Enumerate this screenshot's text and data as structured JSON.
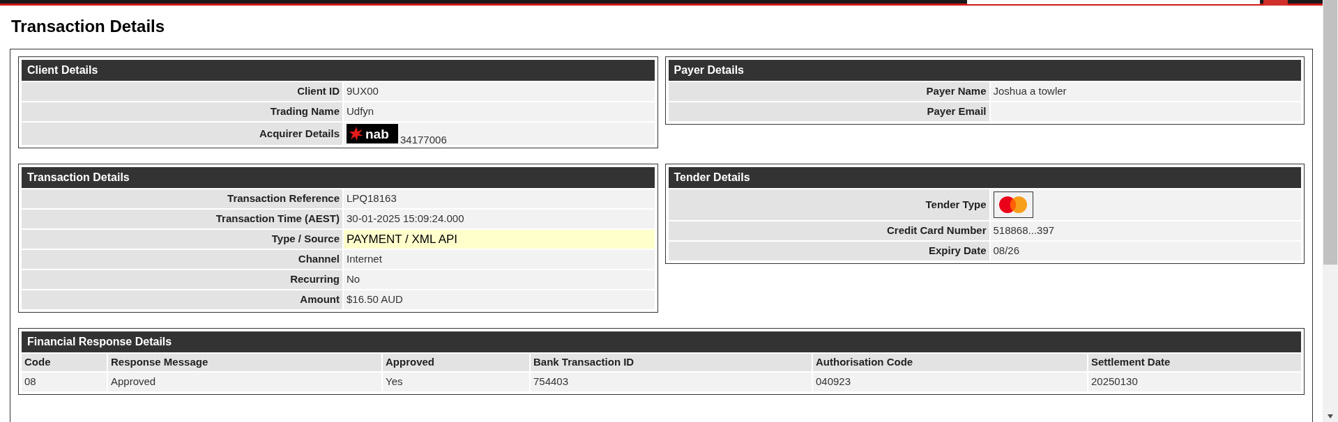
{
  "page_title": "Transaction Details",
  "panels": [
    {
      "title": "Client Details",
      "rows": [
        {
          "label": "Client ID",
          "kind": "text",
          "value": "9UX00",
          "highlighted": false
        },
        {
          "label": "Trading Name",
          "kind": "text",
          "value": "Udfyn",
          "highlighted": false
        },
        {
          "label": "Acquirer Details",
          "kind": "bank_logo",
          "logo_text": "nab",
          "value": "34177006",
          "highlighted": false
        }
      ]
    },
    {
      "title": "Payer Details",
      "rows": [
        {
          "label": "Payer Name",
          "kind": "text",
          "value": "Joshua a towler",
          "highlighted": false
        },
        {
          "label": "Payer Email",
          "kind": "text",
          "highlighted": false
        }
      ]
    },
    {
      "title": "Transaction Details",
      "rows": [
        {
          "label": "Transaction Reference",
          "kind": "text",
          "value": "LPQ18163",
          "highlighted": false
        },
        {
          "label": "Transaction Time (AEST)",
          "kind": "text",
          "value": "30-01-2025 15:09:24.000",
          "highlighted": false
        },
        {
          "label": "Type / Source",
          "kind": "text",
          "value": "PAYMENT / XML API",
          "highlighted": true
        },
        {
          "label": "Channel",
          "kind": "text",
          "value": "Internet",
          "highlighted": false
        },
        {
          "label": "Recurring",
          "kind": "text",
          "value": "No",
          "highlighted": false
        },
        {
          "label": "Amount",
          "kind": "text",
          "value": "$16.50 AUD",
          "highlighted": false
        }
      ]
    },
    {
      "title": "Tender Details",
      "rows": [
        {
          "label": "Tender Type",
          "kind": "card_brand",
          "highlighted": false
        },
        {
          "label": "Credit Card Number",
          "kind": "text",
          "value": "518868...397",
          "highlighted": false
        },
        {
          "label": "Expiry Date",
          "kind": "text",
          "value": "08/26",
          "highlighted": false
        }
      ]
    }
  ],
  "financial": {
    "title": "Financial Response Details",
    "columns": [
      "Code",
      "Response Message",
      "Approved",
      "Bank Transaction ID",
      "Authorisation Code",
      "Settlement Date"
    ],
    "rows": [
      [
        "08",
        "Approved",
        "Yes",
        "754403",
        "040923",
        "20250130"
      ]
    ]
  }
}
